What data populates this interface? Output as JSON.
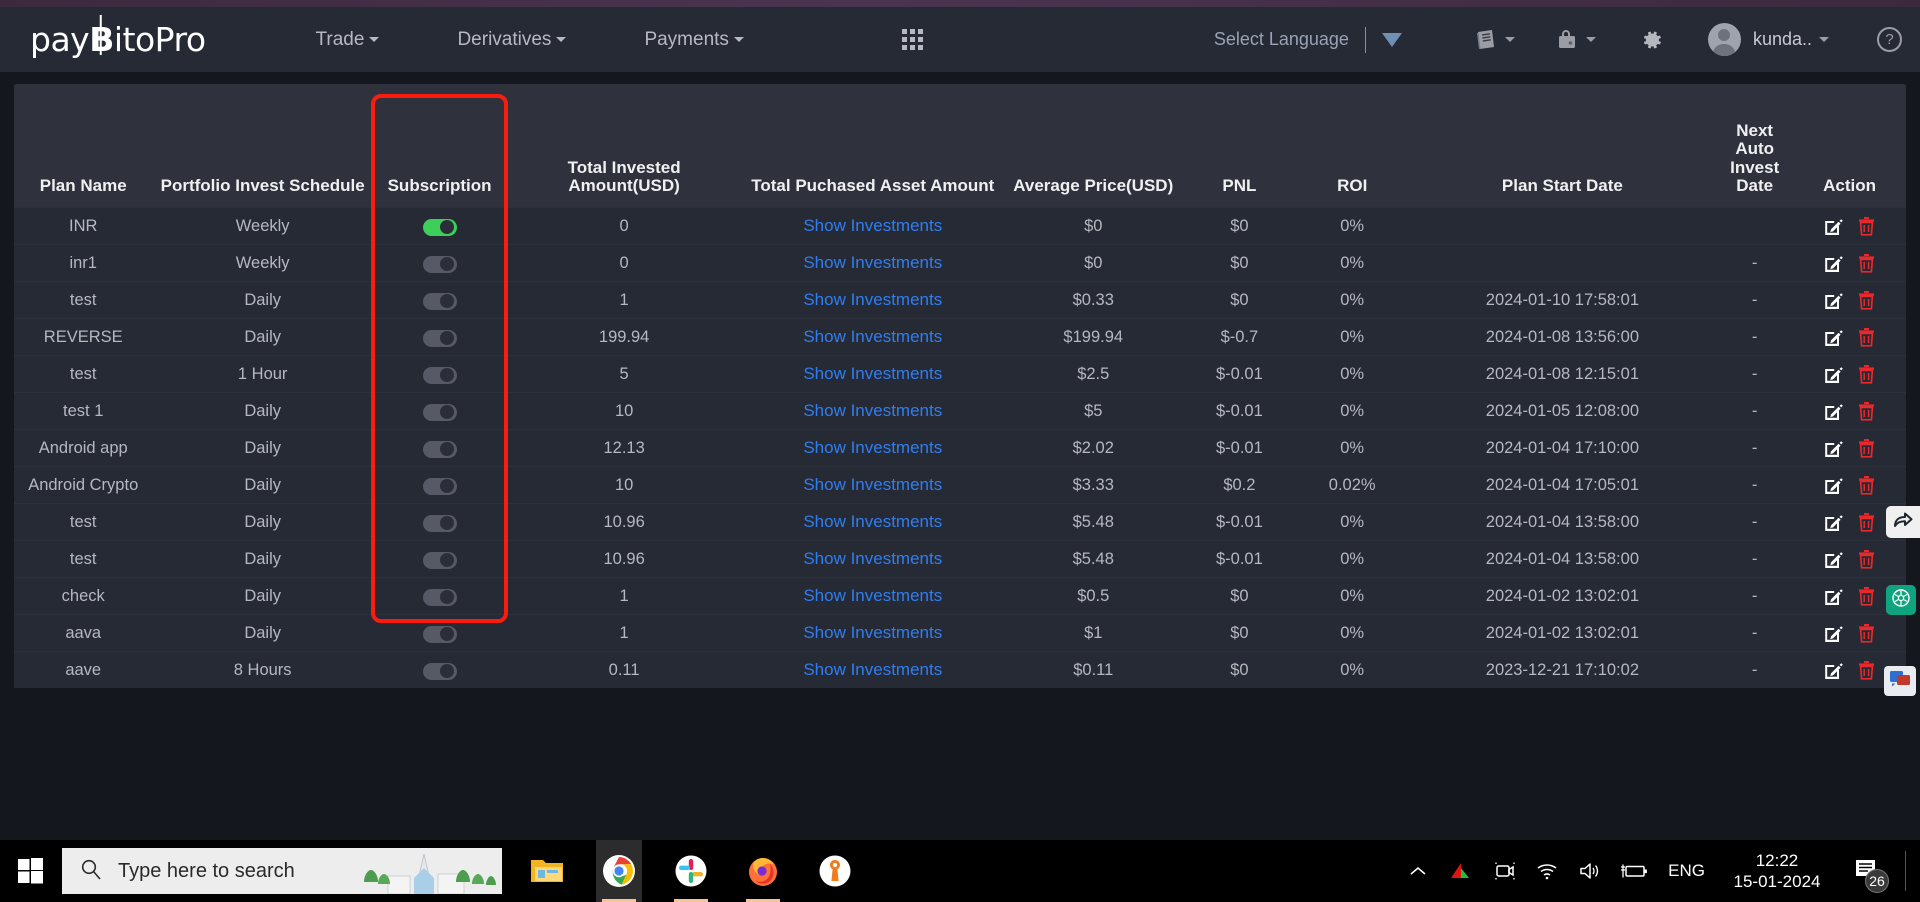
{
  "header": {
    "logo_pre": "pay",
    "logo_b": "B",
    "logo_post": "itoPro",
    "nav": [
      {
        "label": "Trade",
        "icon": "chevron-down-icon"
      },
      {
        "label": "Derivatives",
        "icon": "chevron-down-icon"
      },
      {
        "label": "Payments",
        "icon": "chevron-down-icon"
      }
    ],
    "apps_icon": "grid-apps-icon",
    "language_label": "Select Language",
    "language_caret": "triangle-down-icon",
    "book_icon": "book-icon",
    "wallet_icon": "wallet-lock-icon",
    "settings_icon": "gear-icon",
    "username": "kunda..",
    "help_icon": "question-mark-icon"
  },
  "table": {
    "columns": [
      "Plan Name",
      "Portfolio Invest Schedule",
      "Subscription",
      "Total Invested Amount(USD)",
      "Total Puchased Asset Amount",
      "Average Price(USD)",
      "PNL",
      "ROI",
      "Plan Start Date",
      "Next Auto Invest Date",
      "Action"
    ],
    "show_investments_label": "Show Investments",
    "empty_value": "-",
    "rows": [
      {
        "plan": "INR",
        "schedule": "Weekly",
        "subscription": true,
        "invested": "0",
        "avg": "$0",
        "pnl": "$0",
        "roi": "0%",
        "start": "",
        "next": ""
      },
      {
        "plan": "inr1",
        "schedule": "Weekly",
        "subscription": false,
        "invested": "0",
        "avg": "$0",
        "pnl": "$0",
        "roi": "0%",
        "start": "",
        "next": "-"
      },
      {
        "plan": "test",
        "schedule": "Daily",
        "subscription": false,
        "invested": "1",
        "avg": "$0.33",
        "pnl": "$0",
        "roi": "0%",
        "start": "2024-01-10 17:58:01",
        "next": "-"
      },
      {
        "plan": "REVERSE",
        "schedule": "Daily",
        "subscription": false,
        "invested": "199.94",
        "avg": "$199.94",
        "pnl": "$-0.7",
        "roi": "0%",
        "start": "2024-01-08 13:56:00",
        "next": "-"
      },
      {
        "plan": "test",
        "schedule": "1 Hour",
        "subscription": false,
        "invested": "5",
        "avg": "$2.5",
        "pnl": "$-0.01",
        "roi": "0%",
        "start": "2024-01-08 12:15:01",
        "next": "-"
      },
      {
        "plan": "test 1",
        "schedule": "Daily",
        "subscription": false,
        "invested": "10",
        "avg": "$5",
        "pnl": "$-0.01",
        "roi": "0%",
        "start": "2024-01-05 12:08:00",
        "next": "-"
      },
      {
        "plan": "Android app",
        "schedule": "Daily",
        "subscription": false,
        "invested": "12.13",
        "avg": "$2.02",
        "pnl": "$-0.01",
        "roi": "0%",
        "start": "2024-01-04 17:10:00",
        "next": "-"
      },
      {
        "plan": "Android Crypto",
        "schedule": "Daily",
        "subscription": false,
        "invested": "10",
        "avg": "$3.33",
        "pnl": "$0.2",
        "roi": "0.02%",
        "start": "2024-01-04 17:05:01",
        "next": "-"
      },
      {
        "plan": "test",
        "schedule": "Daily",
        "subscription": false,
        "invested": "10.96",
        "avg": "$5.48",
        "pnl": "$-0.01",
        "roi": "0%",
        "start": "2024-01-04 13:58:00",
        "next": "-"
      },
      {
        "plan": "test",
        "schedule": "Daily",
        "subscription": false,
        "invested": "10.96",
        "avg": "$5.48",
        "pnl": "$-0.01",
        "roi": "0%",
        "start": "2024-01-04 13:58:00",
        "next": "-"
      },
      {
        "plan": "check",
        "schedule": "Daily",
        "subscription": false,
        "invested": "1",
        "avg": "$0.5",
        "pnl": "$0",
        "roi": "0%",
        "start": "2024-01-02 13:02:01",
        "next": "-"
      },
      {
        "plan": "aava",
        "schedule": "Daily",
        "subscription": false,
        "invested": "1",
        "avg": "$1",
        "pnl": "$0",
        "roi": "0%",
        "start": "2024-01-02 13:02:01",
        "next": "-"
      },
      {
        "plan": "aave",
        "schedule": "8 Hours",
        "subscription": false,
        "invested": "0.11",
        "avg": "$0.11",
        "pnl": "$0",
        "roi": "0%",
        "start": "2023-12-21 17:10:02",
        "next": "-"
      }
    ],
    "action_icons": {
      "edit": "edit-pencil-icon",
      "delete": "trash-icon"
    }
  },
  "annotation": {
    "highlight_color": "#fb1c0e",
    "target_column": "Subscription"
  },
  "floating": {
    "share_icon": "share-arrow-icon",
    "gpt_icon": "chatgpt-icon",
    "chat_icon": "chat-bubble-icon"
  },
  "taskbar": {
    "start_icon": "windows-start-icon",
    "search_placeholder": "Type here to search",
    "search_icon": "search-icon",
    "apps": [
      {
        "name": "file-explorer-icon",
        "active": false
      },
      {
        "name": "google-chrome-icon",
        "active": true
      },
      {
        "name": "slack-icon",
        "active": false
      },
      {
        "name": "firefox-icon",
        "active": false
      },
      {
        "name": "bitwarden-icon",
        "active": false
      }
    ],
    "tray": [
      "show-hidden-icons-chevron",
      "vpn-icon",
      "screen-record-icon",
      "wifi-icon",
      "volume-icon",
      "battery-charging-icon"
    ],
    "language": "ENG",
    "time": "12:22",
    "date": "15-01-2024",
    "notification_icon": "notification-icon",
    "notification_count": "26"
  }
}
